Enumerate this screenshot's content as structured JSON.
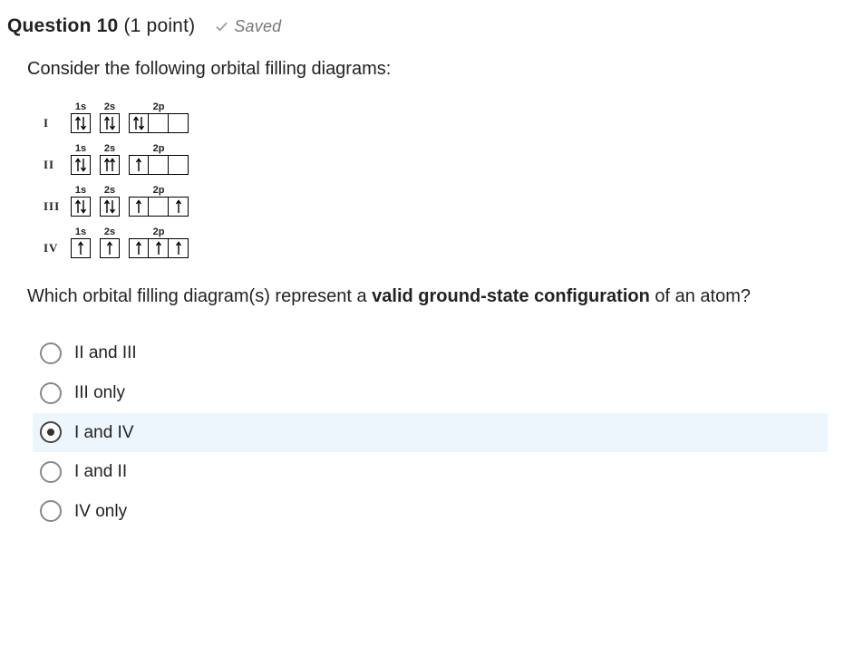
{
  "header": {
    "question_label": "Question 10",
    "points": "(1 point)",
    "saved": "Saved"
  },
  "prompt": "Consider the following orbital filling diagrams:",
  "orbital_labels": {
    "s1": "1s",
    "s2": "2s",
    "p2": "2p"
  },
  "diagrams": [
    {
      "row": "I",
      "orbitals": {
        "1s": [
          "up",
          "down"
        ],
        "2s": [
          "up",
          "down"
        ],
        "2p": [
          [
            "up",
            "down"
          ],
          [],
          []
        ]
      }
    },
    {
      "row": "II",
      "orbitals": {
        "1s": [
          "up",
          "down"
        ],
        "2s": [
          "up",
          "up"
        ],
        "2p": [
          [
            "up"
          ],
          [],
          []
        ]
      }
    },
    {
      "row": "III",
      "orbitals": {
        "1s": [
          "up",
          "down"
        ],
        "2s": [
          "up",
          "down"
        ],
        "2p": [
          [
            "up"
          ],
          [],
          [
            "up"
          ]
        ]
      }
    },
    {
      "row": "IV",
      "orbitals": {
        "1s": [
          "up"
        ],
        "2s": [
          "up"
        ],
        "2p": [
          [
            "up"
          ],
          [
            "up"
          ],
          [
            "up"
          ]
        ]
      }
    }
  ],
  "question_tail": {
    "pre": "Which orbital filling diagram(s) represent a ",
    "bold": "valid ground-state configuration",
    "post": " of an atom?"
  },
  "options": [
    {
      "label": "II and III",
      "selected": false
    },
    {
      "label": "III only",
      "selected": false
    },
    {
      "label": "I and IV",
      "selected": true
    },
    {
      "label": "I and II",
      "selected": false
    },
    {
      "label": "IV only",
      "selected": false
    }
  ]
}
